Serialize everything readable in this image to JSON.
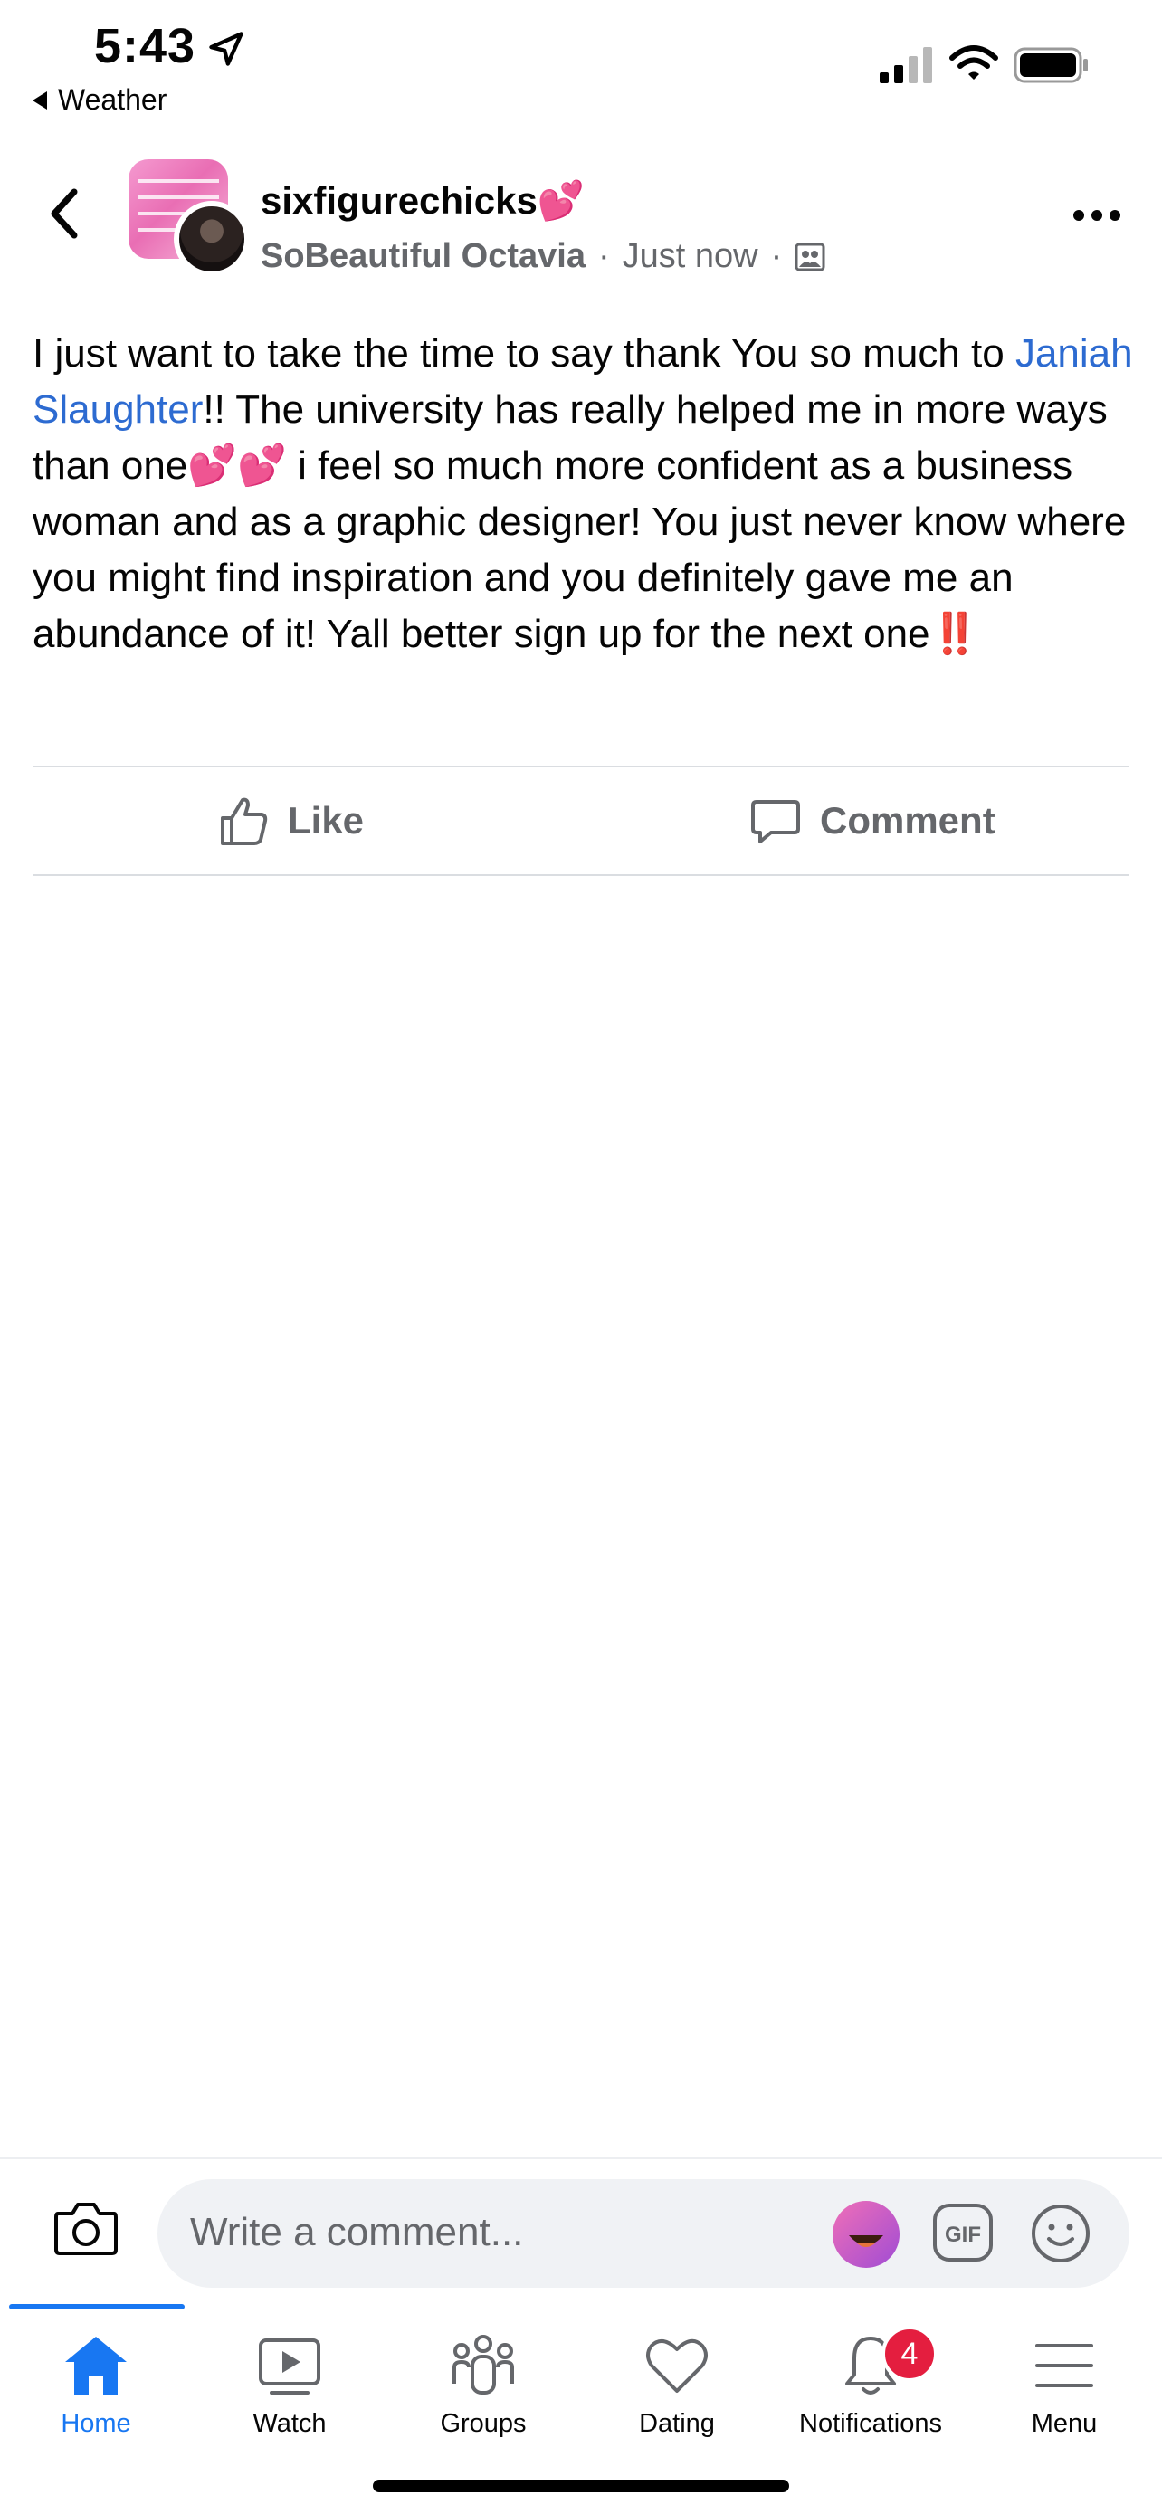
{
  "status_bar": {
    "time": "5:43",
    "back_app": "Weather",
    "icons": [
      "location-arrow-icon",
      "cellular-signal-icon",
      "wifi-icon",
      "battery-icon"
    ]
  },
  "header": {
    "group_name": "sixfigurechicks💕",
    "author": "SoBeautiful Octavia",
    "timestamp": "Just now",
    "separator": "·",
    "icons": [
      "back-chevron-icon",
      "group-privacy-icon",
      "more-options-icon"
    ]
  },
  "post": {
    "text_before_mention": "I just want to take the time to say thank You so much to ",
    "mention": "Janiah Slaughter",
    "text_after_mention": "!! The university has really helped me in more ways than one💕💕 i feel so much more confident as a business woman and as a graphic designer! You just never know where you might find inspiration and you definitely gave me an abundance of it! Yall better sign up for the next one",
    "emphasis": "‼️"
  },
  "actions": {
    "like_label": "Like",
    "comment_label": "Comment"
  },
  "comment_bar": {
    "placeholder": "Write a comment...",
    "gif_label": "GIF"
  },
  "tabs": [
    {
      "label": "Home",
      "active": true
    },
    {
      "label": "Watch",
      "active": false
    },
    {
      "label": "Groups",
      "active": false
    },
    {
      "label": "Dating",
      "active": false
    },
    {
      "label": "Notifications",
      "active": false,
      "badge": "4"
    },
    {
      "label": "Menu",
      "active": false
    }
  ],
  "colors": {
    "accent": "#1877f2",
    "mention": "#2d6bd1",
    "badge": "#e41e3f",
    "secondary_text": "#65676b"
  }
}
